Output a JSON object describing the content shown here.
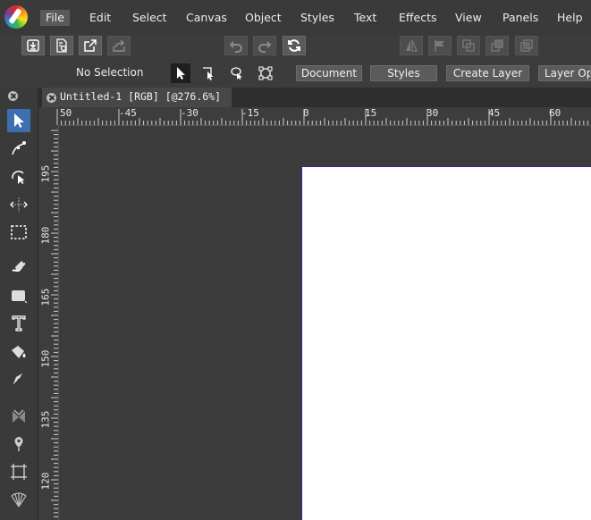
{
  "menubar": {
    "items": [
      "File",
      "Edit",
      "Select",
      "Canvas",
      "Object",
      "Styles",
      "Text",
      "Effects",
      "View",
      "Panels",
      "Help"
    ],
    "active": "File"
  },
  "toolbar": {
    "icons": [
      "import-icon",
      "export-settings-icon",
      "open-external-icon",
      "share-icon",
      "undo-icon",
      "redo-icon",
      "refresh-icon",
      "align-left-icon",
      "flag-icon",
      "boolean-union-icon",
      "boolean-subtract-icon",
      "boolean-intersect-icon"
    ]
  },
  "controlbar": {
    "selection_label": "No Selection",
    "buttons": [
      "Document",
      "Styles",
      "Create Layer",
      "Layer Options"
    ]
  },
  "document": {
    "tab_title": "Untitled-1 [RGB] [@276.6%]"
  },
  "rulers": {
    "horizontal": [
      "50",
      "-45",
      "-30",
      "-15",
      "0",
      "15",
      "30",
      "45",
      "60"
    ],
    "vertical": [
      "195",
      "180",
      "165",
      "150",
      "135",
      "120"
    ]
  },
  "colors": {
    "accent": "#3d6fb0",
    "artboard_border": "#2a2aa0"
  }
}
